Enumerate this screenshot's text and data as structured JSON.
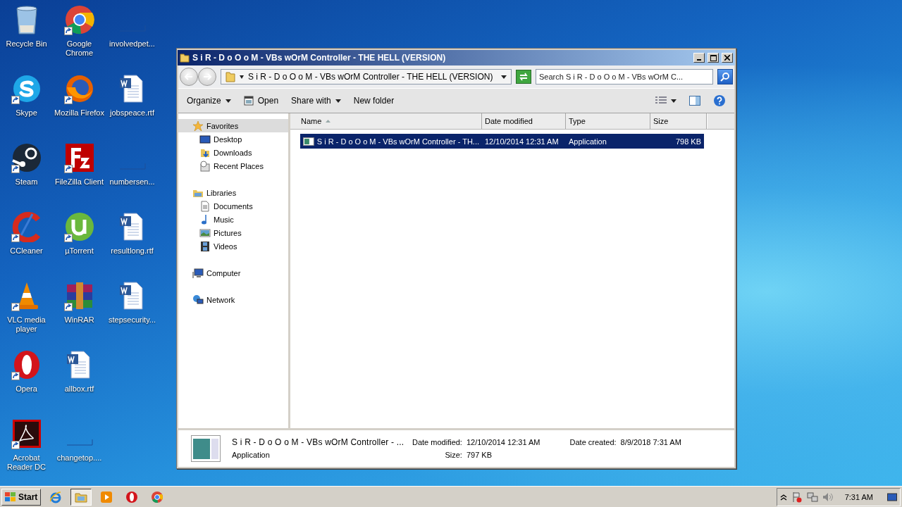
{
  "desktop_icons": [
    {
      "label": "Recycle Bin",
      "kind": "bin",
      "shortcut": false
    },
    {
      "label": "Skype",
      "kind": "skype",
      "shortcut": true
    },
    {
      "label": "Steam",
      "kind": "steam",
      "shortcut": true
    },
    {
      "label": "CCleaner",
      "kind": "ccleaner",
      "shortcut": true
    },
    {
      "label": "VLC media player",
      "kind": "vlc",
      "shortcut": true
    },
    {
      "label": "Opera",
      "kind": "opera",
      "shortcut": true
    },
    {
      "label": "Acrobat Reader DC",
      "kind": "acrobat",
      "shortcut": true
    },
    {
      "label": "Google Chrome",
      "kind": "chrome",
      "shortcut": true
    },
    {
      "label": "Mozilla Firefox",
      "kind": "firefox",
      "shortcut": true
    },
    {
      "label": "FileZilla Client",
      "kind": "filezilla",
      "shortcut": true
    },
    {
      "label": "µTorrent",
      "kind": "utorrent",
      "shortcut": true
    },
    {
      "label": "WinRAR",
      "kind": "winrar",
      "shortcut": true
    },
    {
      "label": "allbox.rtf",
      "kind": "word",
      "shortcut": false
    },
    {
      "label": "changetop....",
      "kind": "blank",
      "shortcut": false
    },
    {
      "label": "involvedpet...",
      "kind": "blank",
      "shortcut": false
    },
    {
      "label": "jobspeace.rtf",
      "kind": "word",
      "shortcut": false
    },
    {
      "label": "numbersen...",
      "kind": "blank",
      "shortcut": false
    },
    {
      "label": "resultlong.rtf",
      "kind": "word",
      "shortcut": false
    },
    {
      "label": "stepsecurity...",
      "kind": "word",
      "shortcut": false
    }
  ],
  "window": {
    "title": "S i R - D o O o M - VBs wOrM Controller - THE HELL (VERSION)",
    "address": {
      "path": "S i R - D o O o M - VBs wOrM Controller - THE HELL (VERSION)"
    },
    "search": {
      "placeholder": "Search S i R - D o O o M - VBs wOrM C..."
    },
    "toolbar": [
      {
        "label": "Organize",
        "kind": "menu"
      },
      {
        "label": "Open",
        "kind": "open"
      },
      {
        "label": "Share with",
        "kind": "menu"
      },
      {
        "label": "New folder",
        "kind": "plain"
      }
    ],
    "nav": [
      {
        "label": "Favorites",
        "kind": "star",
        "selected": true,
        "children": [
          {
            "label": "Desktop",
            "kind": "desktop",
            "selected": false
          },
          {
            "label": "Downloads",
            "kind": "downloads",
            "selected": false
          },
          {
            "label": "Recent Places",
            "kind": "recent",
            "selected": false
          }
        ]
      },
      {
        "label": "Libraries",
        "kind": "library",
        "selected": false,
        "children": [
          {
            "label": "Documents",
            "kind": "documents",
            "selected": false
          },
          {
            "label": "Music",
            "kind": "music",
            "selected": false
          },
          {
            "label": "Pictures",
            "kind": "pictures",
            "selected": false
          },
          {
            "label": "Videos",
            "kind": "videos",
            "selected": false
          }
        ]
      },
      {
        "label": "Computer",
        "kind": "computer",
        "selected": false
      },
      {
        "label": "Network",
        "kind": "network",
        "selected": false
      }
    ],
    "columns": [
      {
        "label": "Name",
        "sorted": true
      },
      {
        "label": "Date modified",
        "sorted": false
      },
      {
        "label": "Type",
        "sorted": false
      },
      {
        "label": "Size",
        "sorted": false
      }
    ],
    "rows": [
      {
        "name": "S i R - D o O o M - VBs wOrM Controller - TH...",
        "date_modified": "12/10/2014 12:31 AM",
        "type": "Application",
        "size": "798 KB",
        "selected": true
      }
    ],
    "details": {
      "name": "S i R - D o O o M - VBs wOrM Controller - ...",
      "type": "Application",
      "fields": [
        {
          "label": "Date modified:",
          "value": "12/10/2014 12:31 AM"
        },
        {
          "label": "Size:",
          "value": "797 KB"
        },
        {
          "label": "Date created:",
          "value": "8/9/2018 7:31 AM"
        }
      ]
    }
  },
  "taskbar": {
    "start": "Start",
    "apps": [
      {
        "kind": "ie",
        "selected": false
      },
      {
        "kind": "explorer",
        "selected": true
      },
      {
        "kind": "media",
        "selected": false
      },
      {
        "kind": "opera",
        "selected": false
      },
      {
        "kind": "chrome",
        "selected": false
      }
    ],
    "clock": "7:31 AM"
  }
}
